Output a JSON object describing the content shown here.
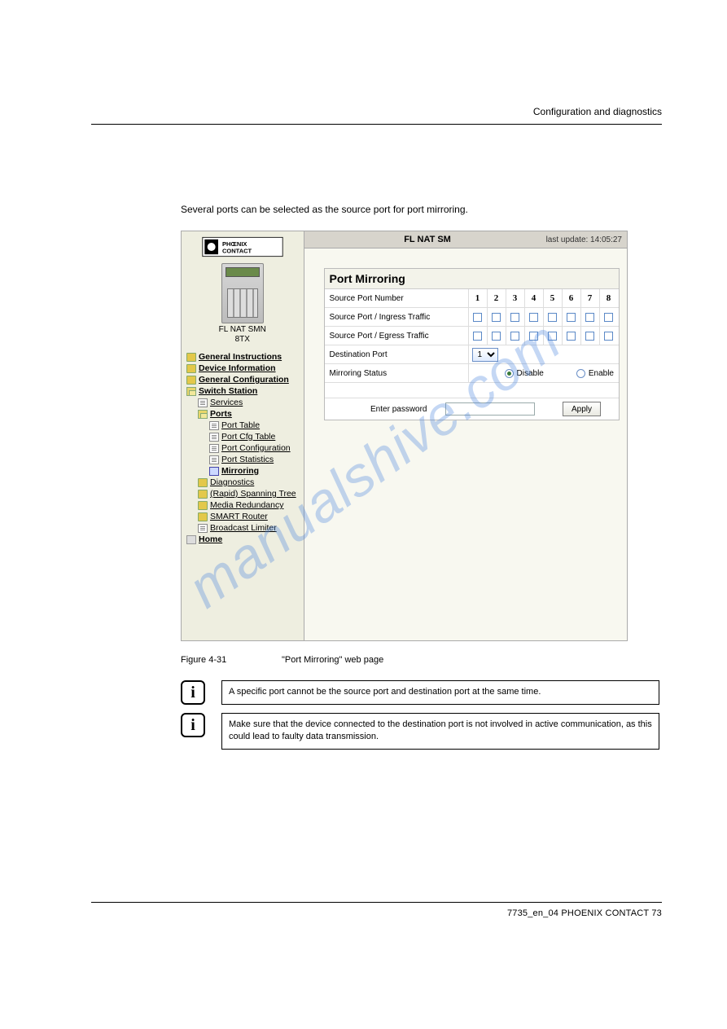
{
  "header": {
    "right": "Configuration and diagnostics"
  },
  "footer": {
    "right": "7735_en_04    PHOENIX CONTACT    73"
  },
  "body": {
    "intro": "Several ports can be selected as the source port for port mirroring."
  },
  "watermark": "manualshive.com",
  "screenshot": {
    "titleBar": {
      "title": "FL NAT SM",
      "update": "last update: 14:05:27"
    },
    "sidebar": {
      "deviceLabel": "FL NAT SMN\n8TX",
      "items": [
        {
          "icon": "folder-closed",
          "label": "General Instructions",
          "indent": 0,
          "bold": true
        },
        {
          "icon": "folder-closed",
          "label": "Device Information",
          "indent": 0,
          "bold": true
        },
        {
          "icon": "folder-closed",
          "label": "General Configuration",
          "indent": 0,
          "bold": true
        },
        {
          "icon": "folder-open",
          "label": "Switch Station",
          "indent": 0,
          "bold": true
        },
        {
          "icon": "doc-ic",
          "label": "Services",
          "indent": 1,
          "bold": false
        },
        {
          "icon": "folder-open",
          "label": "Ports",
          "indent": 1,
          "bold": true
        },
        {
          "icon": "doc-ic",
          "label": "Port Table",
          "indent": 2,
          "bold": false
        },
        {
          "icon": "doc-ic",
          "label": "Port Cfg Table",
          "indent": 2,
          "bold": false
        },
        {
          "icon": "doc-ic",
          "label": "Port Configuration",
          "indent": 2,
          "bold": false
        },
        {
          "icon": "doc-ic",
          "label": "Port Statistics",
          "indent": 2,
          "bold": false
        },
        {
          "icon": "page-ic",
          "label": "Mirroring",
          "indent": 2,
          "bold": true
        },
        {
          "icon": "folder-closed",
          "label": "Diagnostics",
          "indent": 1,
          "bold": false
        },
        {
          "icon": "folder-closed",
          "label": "(Rapid) Spanning Tree",
          "indent": 1,
          "bold": false
        },
        {
          "icon": "folder-closed",
          "label": "Media Redundancy",
          "indent": 1,
          "bold": false
        },
        {
          "icon": "folder-closed",
          "label": "SMART Router",
          "indent": 1,
          "bold": false
        },
        {
          "icon": "doc-ic",
          "label": "Broadcast Limiter",
          "indent": 1,
          "bold": false
        },
        {
          "icon": "home-ic",
          "label": "Home",
          "indent": 0,
          "bold": true
        }
      ]
    },
    "panel": {
      "heading": "Port Mirroring",
      "rows": {
        "sourcePortNumber": "Source Port Number",
        "ingress": "Source Port / Ingress Traffic",
        "egress": "Source Port / Egress Traffic",
        "destination": "Destination Port",
        "status": "Mirroring Status",
        "password": "Enter password",
        "apply": "Apply"
      },
      "ports": [
        "1",
        "2",
        "3",
        "4",
        "5",
        "6",
        "7",
        "8"
      ],
      "destinationValue": "1",
      "statusOptions": {
        "disable": "Disable",
        "enable": "Enable"
      },
      "statusSelected": "disable"
    }
  },
  "figure": {
    "num": "Figure 4-31",
    "caption": "\"Port Mirroring\" web page"
  },
  "notes": {
    "n1": "A specific port cannot be the source port and destination port at the same time.",
    "n2": "Make sure that the device connected to the destination port is not involved in active communication, as this could lead to faulty data transmission."
  }
}
